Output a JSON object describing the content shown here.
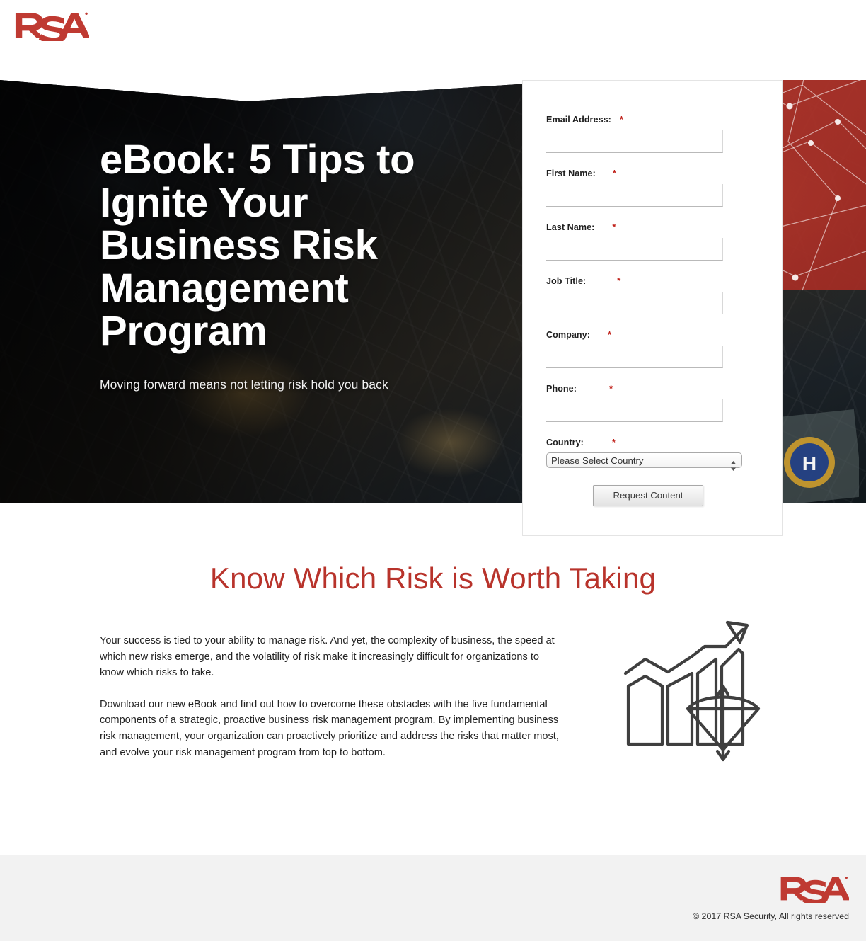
{
  "brand": {
    "logo_alt": "RSA",
    "accent_red": "#b8332b",
    "logo_red": "#bf3a32"
  },
  "hero": {
    "title": "eBook: 5 Tips to Ignite Your Business Risk Management Program",
    "subtitle": "Moving forward means not letting risk hold you back"
  },
  "form": {
    "fields": [
      {
        "label": "Email Address:",
        "required": "*",
        "value": "",
        "placeholder": ""
      },
      {
        "label": "First Name:",
        "required": "*",
        "value": "",
        "placeholder": ""
      },
      {
        "label": "Last Name:",
        "required": "*",
        "value": "",
        "placeholder": ""
      },
      {
        "label": "Job Title:",
        "required": "*",
        "value": "",
        "placeholder": ""
      },
      {
        "label": "Company:",
        "required": "*",
        "value": "",
        "placeholder": ""
      },
      {
        "label": "Phone:",
        "required": "*",
        "value": "",
        "placeholder": ""
      }
    ],
    "country": {
      "label": "Country:",
      "required": "*",
      "selected": "Please Select Country",
      "options": [
        "Please Select Country"
      ]
    },
    "submit_label": "Request Content"
  },
  "main": {
    "heading": "Know Which Risk is Worth Taking",
    "paragraphs": [
      "Your success is tied to your ability to manage risk. And yet, the complexity of business, the speed at which new risks emerge, and the volatility of risk make it increasingly difficult for organizations to know which risks to take.",
      "Download our new eBook and find out how to overcome these obstacles with the five fundamental components of a strategic, proactive business risk management program. By implementing business risk management, your organization can proactively prioritize and address the risks that matter most, and evolve your risk management program from top to bottom."
    ],
    "icon_name": "bar-chart-bow-and-arrow-icon"
  },
  "footer": {
    "logo_alt": "RSA",
    "copyright": "© 2017 RSA Security, All rights reserved"
  }
}
